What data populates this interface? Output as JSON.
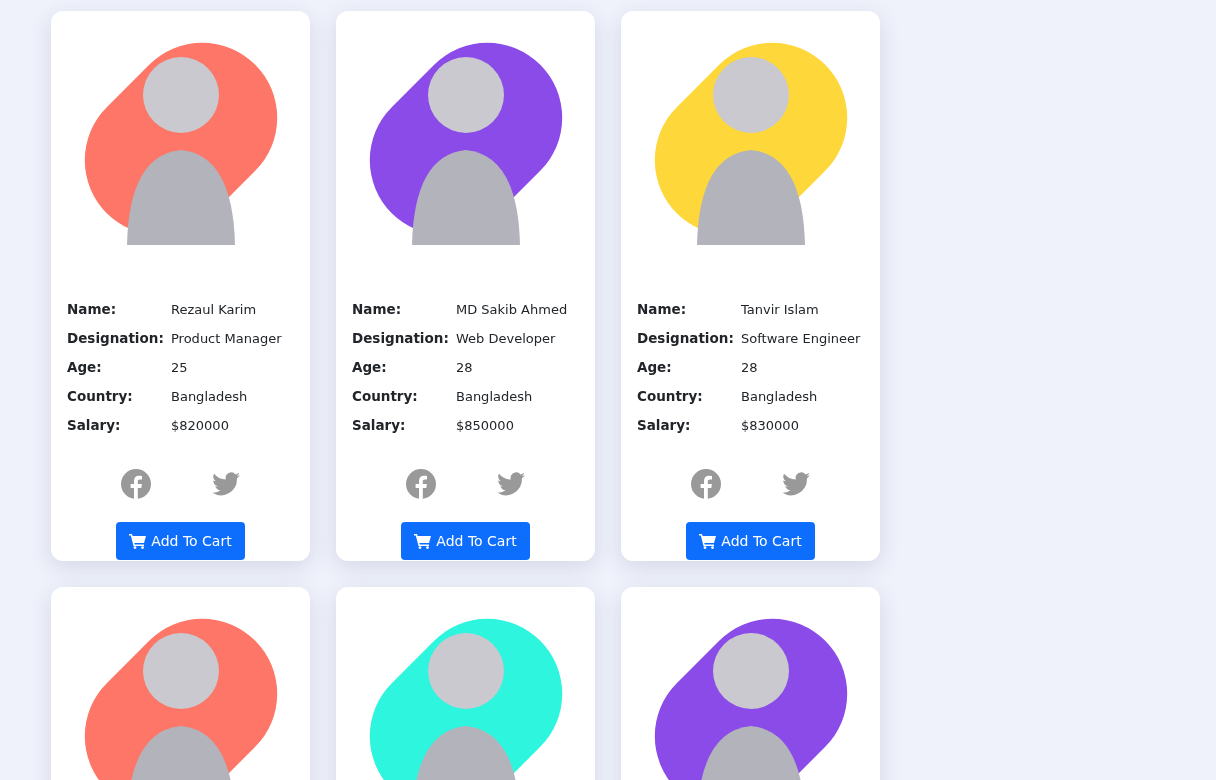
{
  "cards": [
    {
      "color": "#fd7668",
      "details": [
        {
          "label": "Name:",
          "value": "Rezaul Karim"
        },
        {
          "label": "Designation:",
          "value": "Product Manager"
        },
        {
          "label": "Age:",
          "value": "25"
        },
        {
          "label": "Country:",
          "value": "Bangladesh"
        },
        {
          "label": "Salary:",
          "value": "$820000"
        }
      ],
      "button": "Add To Cart"
    },
    {
      "color": "#8b4be8",
      "details": [
        {
          "label": "Name:",
          "value": "MD Sakib Ahmed"
        },
        {
          "label": "Designation:",
          "value": "Web Developer"
        },
        {
          "label": "Age:",
          "value": "28"
        },
        {
          "label": "Country:",
          "value": "Bangladesh"
        },
        {
          "label": "Salary:",
          "value": "$850000"
        }
      ],
      "button": "Add To Cart"
    },
    {
      "color": "#fed73a",
      "details": [
        {
          "label": "Name:",
          "value": "Tanvir Islam"
        },
        {
          "label": "Designation:",
          "value": "Software Engineer"
        },
        {
          "label": "Age:",
          "value": "28"
        },
        {
          "label": "Country:",
          "value": "Bangladesh"
        },
        {
          "label": "Salary:",
          "value": "$830000"
        }
      ],
      "button": "Add To Cart"
    },
    {
      "color": "#fd7668"
    },
    {
      "color": "#2ef5de"
    },
    {
      "color": "#8b4be8"
    }
  ]
}
